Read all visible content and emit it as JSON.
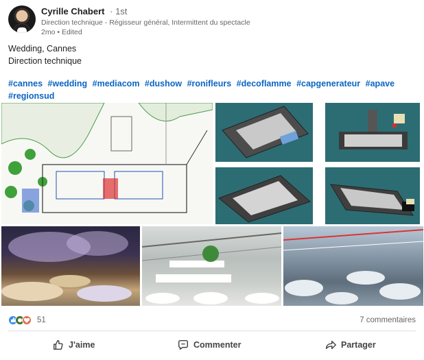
{
  "author": {
    "name": "Cyrille Chabert",
    "degree": "1st",
    "headline": "Direction technique - Régisseur général, Intermittent du spectacle",
    "time": "2mo",
    "edited": "Edited",
    "meta_separator": "•"
  },
  "post": {
    "lines": [
      "Wedding, Cannes",
      "Direction technique"
    ],
    "hashtags": [
      "#cannes",
      "#wedding",
      "#mediacom",
      "#dushow",
      "#ronifleurs",
      "#decoflamme",
      "#capgenerateur",
      "#apave",
      "#regionsud"
    ]
  },
  "images": [
    {
      "name": "floor-plan",
      "icon": "site-plan"
    },
    {
      "name": "render-1",
      "icon": "3d-render"
    },
    {
      "name": "render-2",
      "icon": "3d-render"
    },
    {
      "name": "render-3",
      "icon": "3d-render"
    },
    {
      "name": "render-4",
      "icon": "3d-render"
    },
    {
      "name": "photo-event",
      "icon": "photo"
    },
    {
      "name": "render-interior-1",
      "icon": "3d-render"
    },
    {
      "name": "render-interior-2",
      "icon": "3d-render"
    }
  ],
  "social": {
    "reaction_count": "51",
    "reaction_icons": [
      "like-icon",
      "celebrate-icon",
      "love-icon"
    ],
    "comments": "7 commentaires"
  },
  "actions": {
    "like": "J'aime",
    "comment": "Commenter",
    "share": "Partager"
  },
  "colors": {
    "accent": "#0a66c2",
    "render_background": "#2c6d74"
  }
}
